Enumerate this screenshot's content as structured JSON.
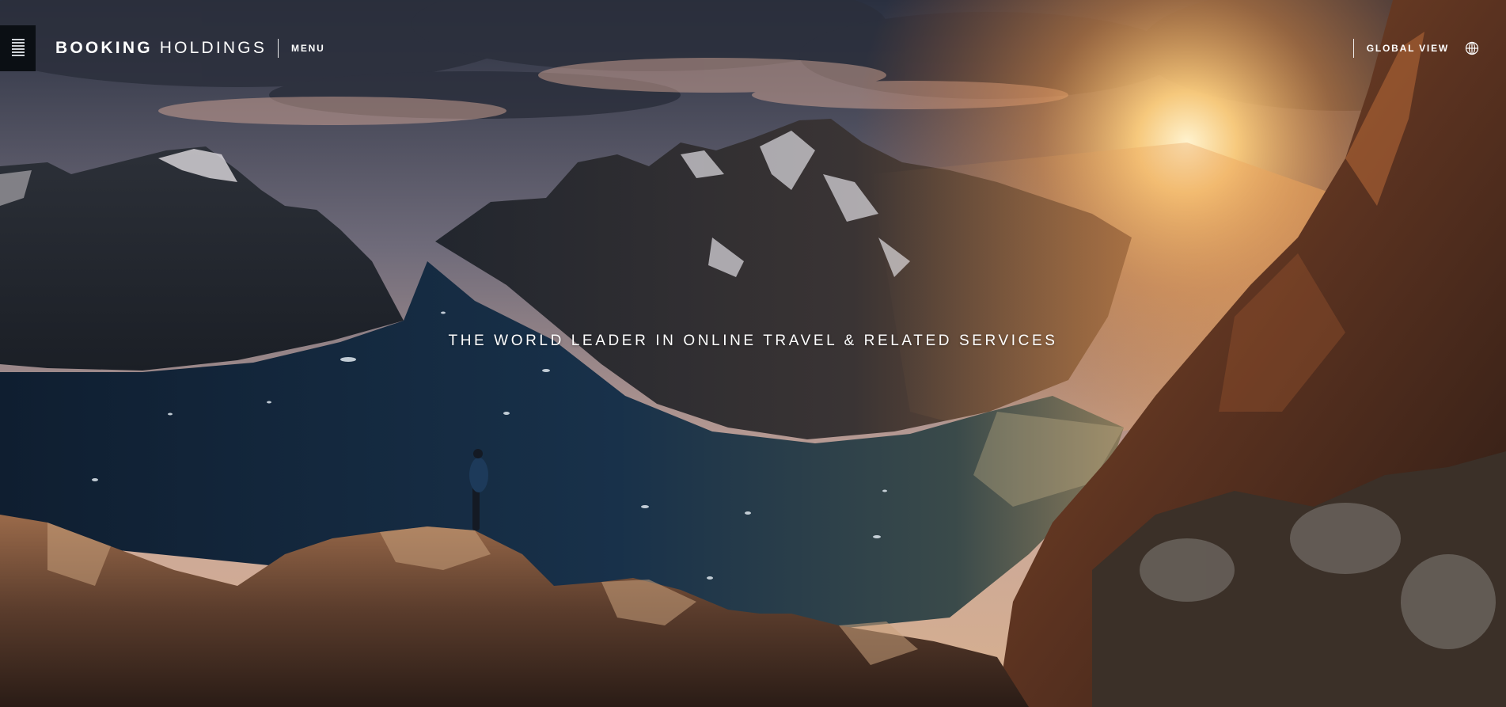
{
  "header": {
    "brand_bold": "BOOKING",
    "brand_light": "HOLDINGS",
    "menu_label": "MENU",
    "global_view_label": "GLOBAL VIEW",
    "logo_icon": "stripes-logo-icon",
    "globe_icon": "globe-icon"
  },
  "hero": {
    "tagline": "THE WORLD LEADER IN ONLINE TRAVEL & RELATED SERVICES",
    "image": "fjord-sunset-landscape"
  },
  "colors": {
    "text": "#ffffff",
    "logo_bg": "#0b0f14",
    "sky_warm": "#f3b46a",
    "water": "#14263a"
  }
}
